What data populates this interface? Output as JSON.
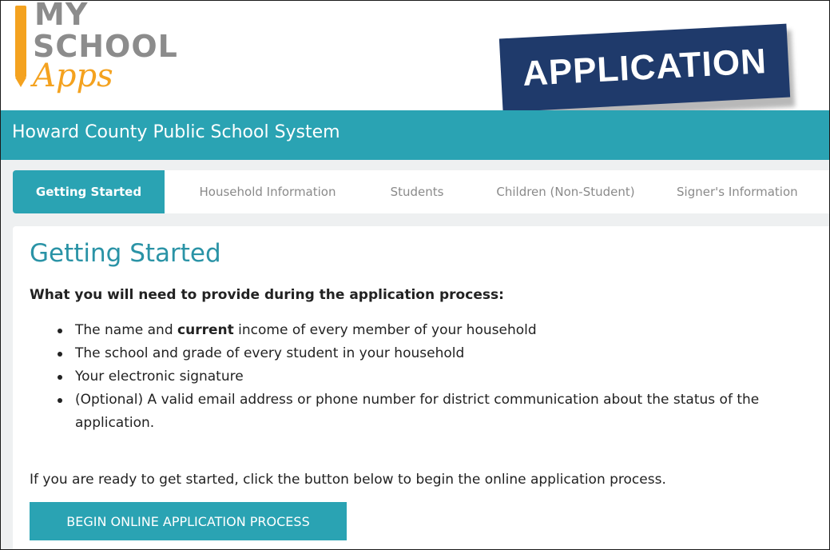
{
  "logo": {
    "line1": "MY",
    "line2": "SCHOOL",
    "line3": "Apps"
  },
  "banner": {
    "label": "APPLICATION"
  },
  "header": {
    "title": "Howard County Public School System"
  },
  "tabs": [
    {
      "label": "Getting Started",
      "active": true
    },
    {
      "label": "Household Information",
      "active": false
    },
    {
      "label": "Students",
      "active": false
    },
    {
      "label": "Children (Non-Student)",
      "active": false
    },
    {
      "label": "Signer's Information",
      "active": false
    }
  ],
  "main": {
    "title": "Getting Started",
    "subtitle": "What you will need to provide during the application process:",
    "requirements": {
      "item1_pre": "The name and ",
      "item1_bold": "current",
      "item1_post": " income of every member of your household",
      "item2": "The school and grade of every student in your household",
      "item3": "Your electronic signature",
      "item4": "(Optional) A valid email address or phone number for district communication about the status of the application."
    },
    "ready_text": "If you are ready to get started, click the button below to begin the online application process.",
    "begin_button": "BEGIN ONLINE APPLICATION PROCESS"
  },
  "colors": {
    "teal": "#2aa3b3",
    "title_teal": "#2a93a6",
    "banner_navy": "#1f3a6b",
    "logo_orange": "#f4a21f",
    "logo_gray": "#8c8c8c"
  }
}
